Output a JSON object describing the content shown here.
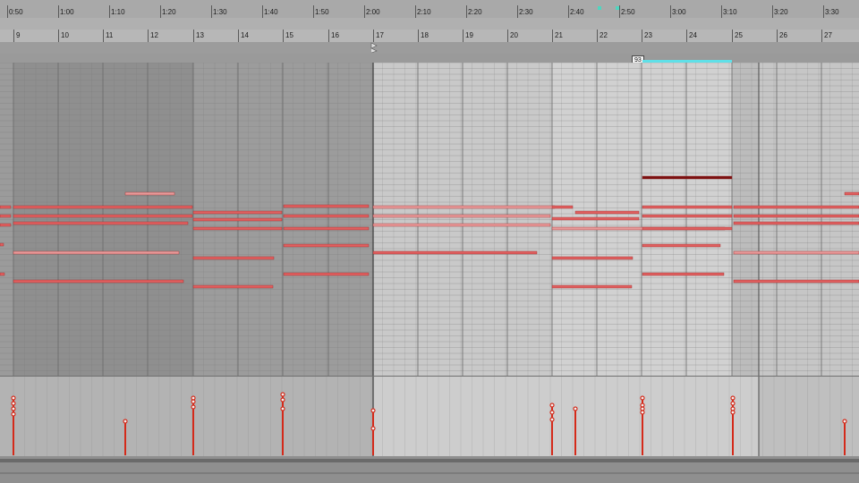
{
  "time_ruler": {
    "labels": [
      "0:50",
      "1:00",
      "1:10",
      "1:20",
      "1:30",
      "1:40",
      "1:50",
      "2:00",
      "2:10",
      "2:20",
      "2:30",
      "2:40",
      "2:50",
      "3:00",
      "3:10",
      "3:20",
      "3:30"
    ]
  },
  "bar_ruler": {
    "labels": [
      "9",
      "10",
      "11",
      "12",
      "13",
      "14",
      "15",
      "16",
      "17",
      "18",
      "19",
      "20",
      "21",
      "22",
      "23",
      "24",
      "25",
      "26",
      "27"
    ]
  },
  "loop": {
    "chip_text": "93"
  },
  "colors": {
    "note": "#e06060",
    "note_dim": "#e89a9a",
    "note_selected": "#7a1010",
    "velocity": "#d42a1a",
    "grid_dark": "#8e8e8e",
    "grid_light": "#c9c9c9",
    "loop_brace": "#5fe0e8"
  },
  "icons": [
    "loop-start-marker-icon",
    "playhead-marker-icon"
  ]
}
